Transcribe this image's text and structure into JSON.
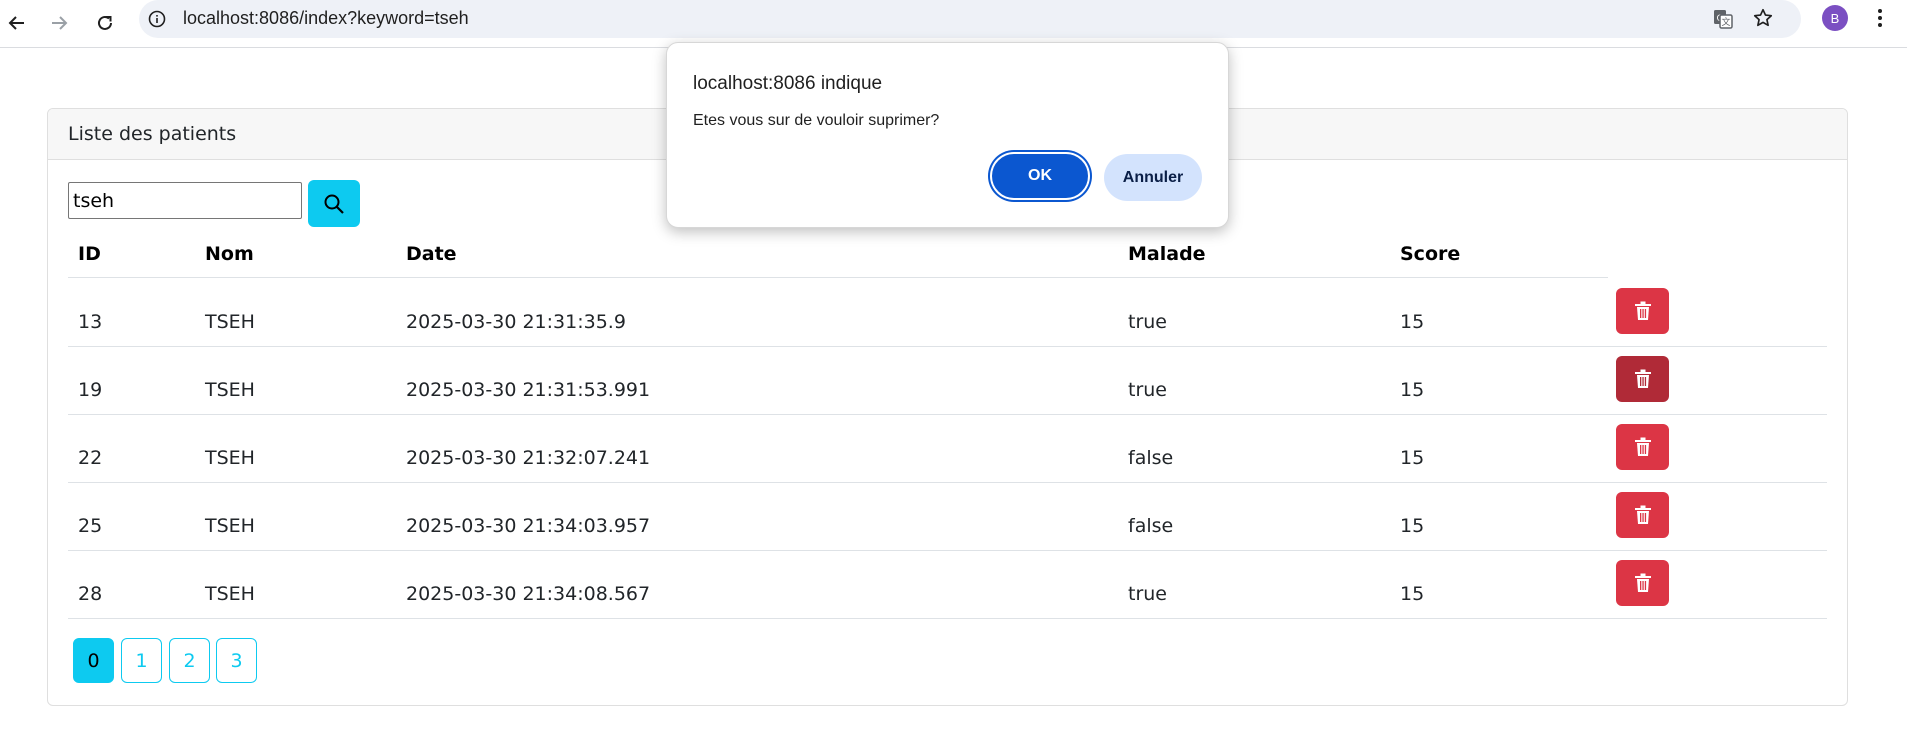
{
  "browser": {
    "url": "localhost:8086/index?keyword=tseh",
    "profile_initial": "B"
  },
  "card": {
    "title": "Liste des patients",
    "search_value": "tseh"
  },
  "table": {
    "headers": [
      "ID",
      "Nom",
      "Date",
      "Malade",
      "Score"
    ],
    "rows": [
      {
        "id": "13",
        "nom": "TSEH",
        "date": "2025-03-30 21:31:35.9",
        "malade": "true",
        "score": "15"
      },
      {
        "id": "19",
        "nom": "TSEH",
        "date": "2025-03-30 21:31:53.991",
        "malade": "true",
        "score": "15"
      },
      {
        "id": "22",
        "nom": "TSEH",
        "date": "2025-03-30 21:32:07.241",
        "malade": "false",
        "score": "15"
      },
      {
        "id": "25",
        "nom": "TSEH",
        "date": "2025-03-30 21:34:03.957",
        "malade": "false",
        "score": "15"
      },
      {
        "id": "28",
        "nom": "TSEH",
        "date": "2025-03-30 21:34:08.567",
        "malade": "true",
        "score": "15"
      }
    ]
  },
  "pagination": {
    "pages": [
      "0",
      "1",
      "2",
      "3"
    ],
    "active": "0"
  },
  "dialog": {
    "title": "localhost:8086 indique",
    "message": "Etes vous sur de vouloir suprimer?",
    "ok_label": "OK",
    "cancel_label": "Annuler"
  },
  "colors": {
    "info": "#0dcaf0",
    "danger": "#dc3545",
    "danger_hover": "#b02a37",
    "dialog_primary": "#0b57d0",
    "dialog_secondary": "#d3e3fd"
  },
  "icons": [
    "back-arrow-icon",
    "forward-arrow-icon",
    "reload-icon",
    "site-info-icon",
    "translate-icon",
    "star-icon",
    "more-vert-icon",
    "search-icon",
    "trash-icon"
  ]
}
